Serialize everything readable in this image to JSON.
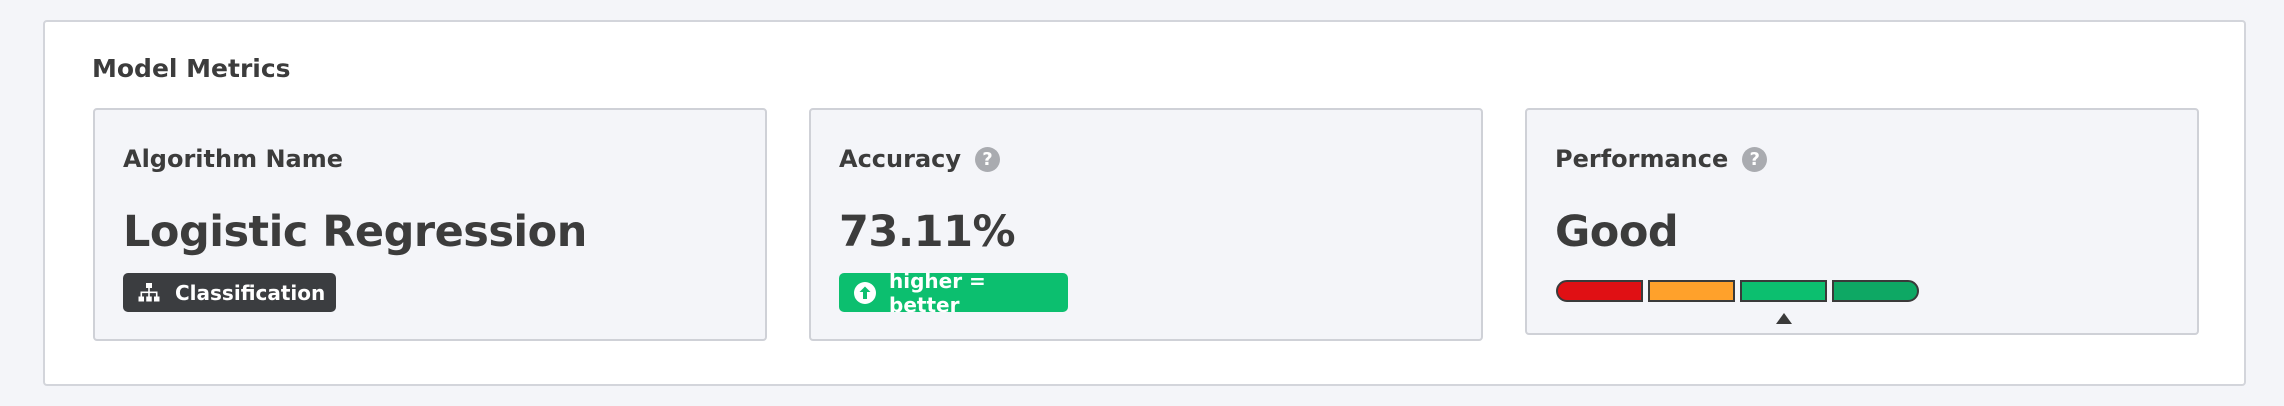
{
  "panel": {
    "title": "Model Metrics"
  },
  "cards": {
    "algorithm": {
      "label": "Algorithm Name",
      "value": "Logistic Regression",
      "badge_label": "Classification",
      "badge_icon": "hierarchy-icon"
    },
    "accuracy": {
      "label": "Accuracy",
      "help_icon": "help-icon",
      "help_glyph": "?",
      "value": "73.11%",
      "badge_label": "higher = better",
      "badge_icon": "arrow-up-circle-icon"
    },
    "performance": {
      "label": "Performance",
      "help_icon": "help-icon",
      "help_glyph": "?",
      "value": "Good",
      "scale": {
        "segment_colors": [
          "#e01014",
          "#ffa12b",
          "#0cbf6f",
          "#0ea864"
        ],
        "selected_index": 2
      }
    }
  },
  "colors": {
    "background": "#f4f5f9",
    "panel": "#ffffff",
    "text": "#3c3c3c",
    "badge_dark": "#3b3d40",
    "badge_green": "#0cbf6f",
    "help_icon": "#a9abb0"
  }
}
